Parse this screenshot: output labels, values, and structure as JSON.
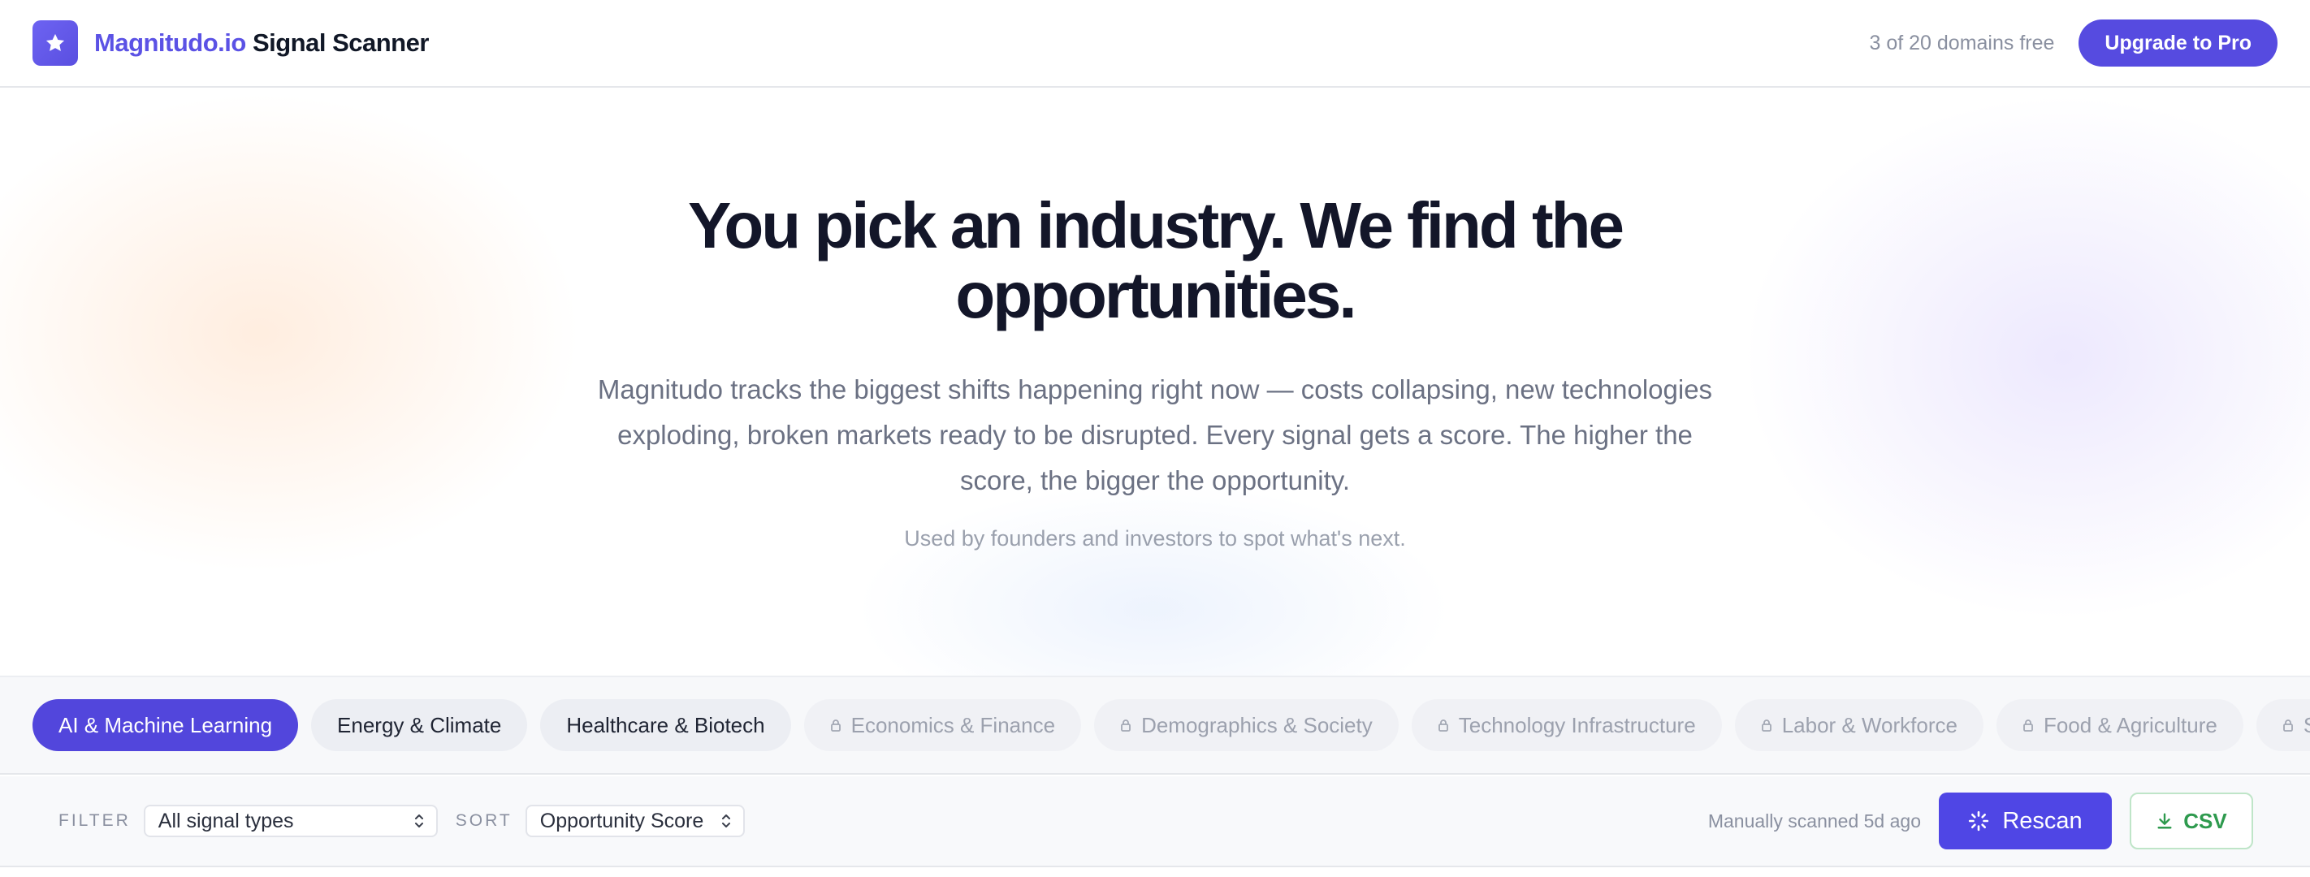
{
  "header": {
    "brand_accent": "Magnitudo.io",
    "brand_rest": " Signal Scanner",
    "free_count": "3 of 20 domains free",
    "upgrade_label": "Upgrade to Pro",
    "logo_icon": "star-icon"
  },
  "hero": {
    "title": "You pick an industry. We find the opportunities.",
    "subtitle": "Magnitudo tracks the biggest shifts happening right now — costs collapsing, new technologies exploding, broken markets ready to be disrupted. Every signal gets a score. The higher the score, the bigger the opportunity.",
    "note": "Used by founders and investors to spot what's next."
  },
  "categories": [
    {
      "label": "AI & Machine Learning",
      "state": "active"
    },
    {
      "label": "Energy & Climate",
      "state": "available"
    },
    {
      "label": "Healthcare & Biotech",
      "state": "available"
    },
    {
      "label": "Economics & Finance",
      "state": "locked"
    },
    {
      "label": "Demographics & Society",
      "state": "locked"
    },
    {
      "label": "Technology Infrastructure",
      "state": "locked"
    },
    {
      "label": "Labor & Workforce",
      "state": "locked"
    },
    {
      "label": "Food & Agriculture",
      "state": "locked"
    },
    {
      "label": "Space",
      "state": "locked"
    }
  ],
  "filters": {
    "filter_label": "FILTER",
    "filter_value": "All signal types",
    "sort_label": "SORT",
    "sort_value": "Opportunity Score",
    "scan_status": "Manually scanned 5d ago",
    "rescan_label": "Rescan",
    "csv_label": "CSV"
  },
  "colors": {
    "brand": "#5b52e5",
    "active_chip": "#5246dc",
    "csv_green": "#2e9a4e"
  }
}
